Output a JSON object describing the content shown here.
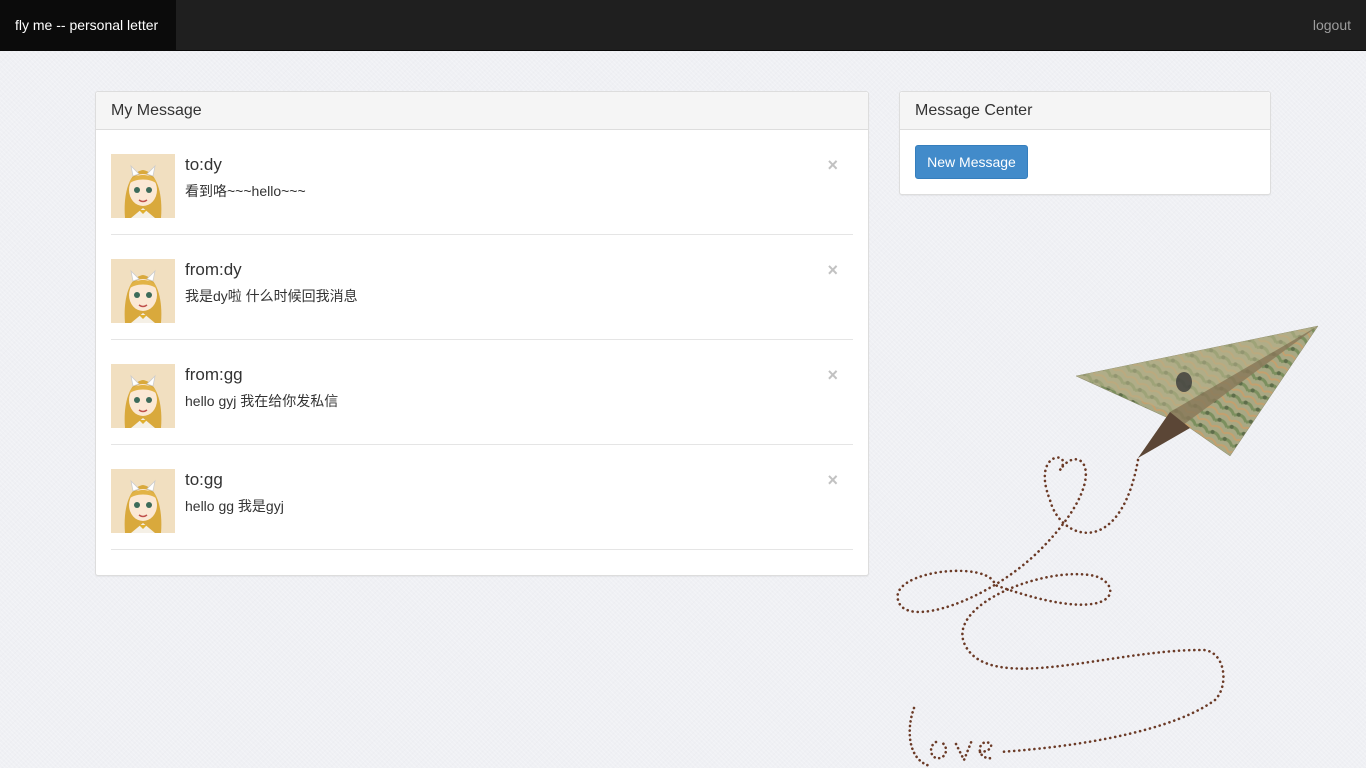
{
  "navbar": {
    "brand": "fly me -- personal letter",
    "logout": "logout"
  },
  "my_message": {
    "title": "My Message",
    "items": [
      {
        "title": "to:dy",
        "body": "看到咯~~~hello~~~",
        "close": "×"
      },
      {
        "title": "from:dy",
        "body": "我是dy啦 什么时候回我消息",
        "close": "×"
      },
      {
        "title": "from:gg",
        "body": "hello gyj 我在给你发私信",
        "close": "×"
      },
      {
        "title": "to:gg",
        "body": "hello gg 我是gyj",
        "close": "×"
      }
    ]
  },
  "message_center": {
    "title": "Message Center",
    "new_button": "New Message"
  },
  "decoration": {
    "text": "Love",
    "dot_color": "#6b3a26"
  },
  "colors": {
    "navbar_bg": "#1f1f1f",
    "brand_bg": "#0b0b0b",
    "primary_button": "#428bca"
  }
}
